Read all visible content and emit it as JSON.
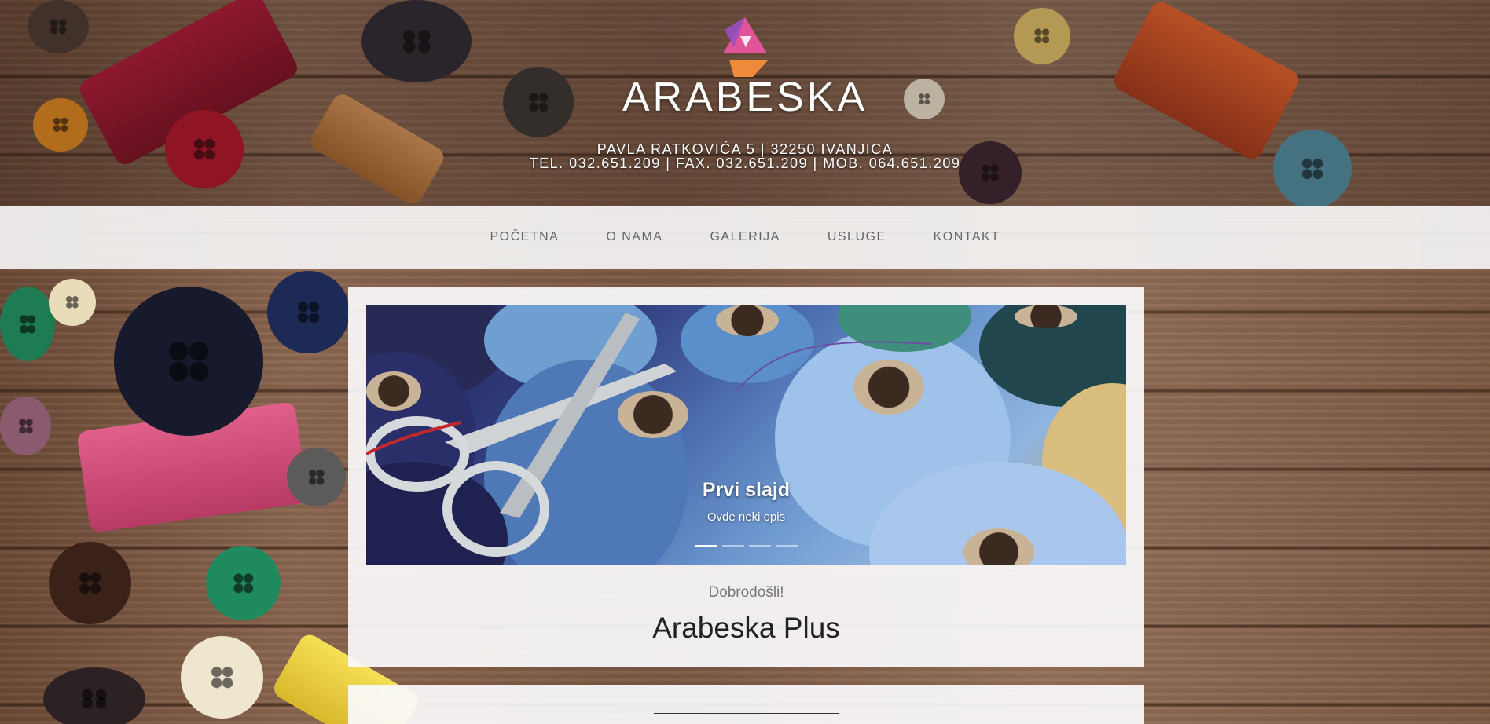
{
  "brand": {
    "name": "ARABESKA",
    "address_line1": "PAVLA RATKOVIĆA 5 | 32250 IVANJICA",
    "address_line2": "TEL. 032.651.209 | FAX. 032.651.209 | MOB. 064.651.209",
    "colors": {
      "logo_pink": "#e0559a",
      "logo_purple": "#9a4fc2",
      "logo_orange": "#f08a3b"
    }
  },
  "nav": {
    "items": [
      {
        "label": "POČETNA"
      },
      {
        "label": "O NAMA"
      },
      {
        "label": "GALERIJA"
      },
      {
        "label": "USLUGE"
      },
      {
        "label": "KONTAKT"
      }
    ]
  },
  "slider": {
    "title": "Prvi slajd",
    "description": "Ovde neki opis",
    "indicator_count": 4,
    "active_index": 0
  },
  "main": {
    "welcome": "Dobrodošli!",
    "title": "Arabeska Plus"
  }
}
